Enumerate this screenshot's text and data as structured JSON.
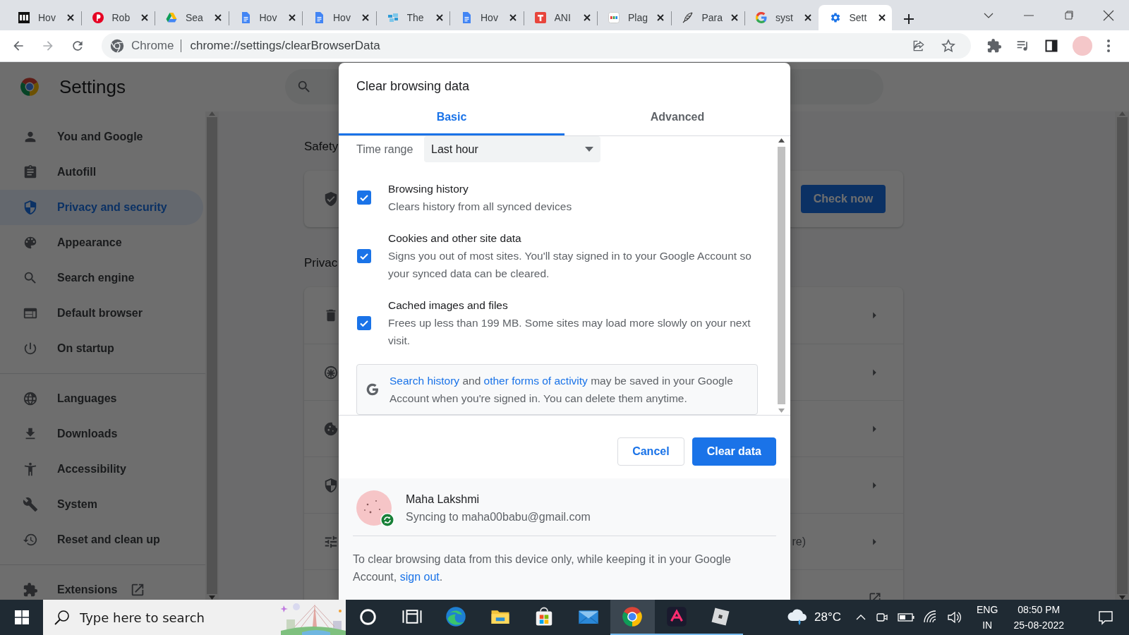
{
  "browser_tabs": [
    {
      "title": "Hov",
      "selected": false
    },
    {
      "title": "Rob",
      "selected": false
    },
    {
      "title": "Sea",
      "selected": false
    },
    {
      "title": "Hov",
      "selected": false
    },
    {
      "title": "Hov",
      "selected": false
    },
    {
      "title": "The",
      "selected": false
    },
    {
      "title": "Hov",
      "selected": false
    },
    {
      "title": "ANI",
      "selected": false
    },
    {
      "title": "Plag",
      "selected": false
    },
    {
      "title": "Para",
      "selected": false
    },
    {
      "title": "syst",
      "selected": false
    },
    {
      "title": "Sett",
      "selected": true
    }
  ],
  "address_bar": {
    "site_label": "Chrome",
    "url": "chrome://settings/clearBrowserData"
  },
  "settings": {
    "title": "Settings",
    "sidebar": [
      {
        "items": [
          {
            "label": "You and Google",
            "selected": false
          },
          {
            "label": "Autofill",
            "selected": false
          },
          {
            "label": "Privacy and security",
            "selected": true
          },
          {
            "label": "Appearance",
            "selected": false
          },
          {
            "label": "Search engine",
            "selected": false
          },
          {
            "label": "Default browser",
            "selected": false
          },
          {
            "label": "On startup",
            "selected": false
          }
        ]
      },
      {
        "items": [
          {
            "label": "Languages",
            "selected": false
          },
          {
            "label": "Downloads",
            "selected": false
          },
          {
            "label": "Accessibility",
            "selected": false
          },
          {
            "label": "System",
            "selected": false
          },
          {
            "label": "Reset and clean up",
            "selected": false
          }
        ]
      },
      {
        "items": [
          {
            "label": "Extensions",
            "selected": false
          }
        ]
      }
    ],
    "sections": [
      {
        "heading": "Safety",
        "rows": [
          {
            "kind": "button",
            "button": "Check now"
          }
        ]
      },
      {
        "heading": "Privac",
        "rows": [
          {
            "kind": "arrow"
          },
          {
            "kind": "arrow"
          },
          {
            "kind": "arrow"
          },
          {
            "kind": "arrow"
          },
          {
            "kind": "arrow",
            "text_fragment": "re)"
          },
          {
            "kind": "external"
          }
        ]
      }
    ]
  },
  "dialog": {
    "title": "Clear browsing data",
    "tabs": [
      {
        "label": "Basic",
        "selected": true
      },
      {
        "label": "Advanced",
        "selected": false
      }
    ],
    "time_range": {
      "label": "Time range",
      "value": "Last hour"
    },
    "options": [
      {
        "title": "Browsing history",
        "description": "Clears history from all synced devices",
        "checked": true
      },
      {
        "title": "Cookies and other site data",
        "description": "Signs you out of most sites. You'll stay signed in to your Google Account so your synced data can be cleared.",
        "checked": true
      },
      {
        "title": "Cached images and files",
        "description": "Frees up less than 199 MB. Some sites may load more slowly on your next visit.",
        "checked": true
      }
    ],
    "notice": [
      {
        "text": "Search history",
        "link": true
      },
      {
        "text": " and ",
        "link": false
      },
      {
        "text": "other forms of activity",
        "link": true
      },
      {
        "text": " may be saved in your Google Account when you're signed in. You can delete them anytime.",
        "link": false
      }
    ],
    "buttons": [
      {
        "label": "Cancel",
        "kind": "secondary"
      },
      {
        "label": "Clear data",
        "kind": "primary"
      }
    ],
    "account": {
      "name": "Maha Lakshmi",
      "status": "Syncing to maha00babu@gmail.com"
    },
    "footer": [
      {
        "text": "To clear browsing data from this device only, while keeping it in your Google Account, ",
        "link": false
      },
      {
        "text": "sign out",
        "link": true
      },
      {
        "text": ".",
        "link": false
      }
    ]
  },
  "taskbar": {
    "search": {
      "placeholder": "Type here to search"
    },
    "apps": [
      {
        "running": false,
        "selected": false
      },
      {
        "running": false,
        "selected": false
      },
      {
        "running": false,
        "selected": false
      },
      {
        "running": false,
        "selected": false
      },
      {
        "running": false,
        "selected": false
      },
      {
        "running": false,
        "selected": false
      },
      {
        "running": true,
        "selected": true
      },
      {
        "running": true,
        "selected": false
      },
      {
        "running": true,
        "selected": false
      }
    ],
    "weather": "28°C",
    "language": "ENG",
    "region": "IN",
    "time": "08:50 PM",
    "date": "25-08-2022"
  }
}
